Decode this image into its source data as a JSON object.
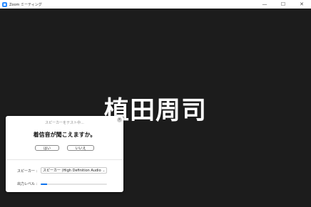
{
  "window": {
    "title": "Zoom ミーティング",
    "controls": [
      "—",
      "☐",
      "✕"
    ]
  },
  "participant": {
    "name": "植田周司"
  },
  "audio_test": {
    "status": "スピーカーをテスト中...",
    "question": "着信音が聞こえますか。",
    "yes_label": "はい",
    "no_label": "いいえ",
    "close_symbol": "×",
    "speaker_label": "スピーカー :",
    "speaker_value": "スピーカー (High Definition Audio Dev...",
    "output_label": "出力レベル :",
    "output_level": 0.1,
    "chevron": "⌄"
  },
  "colors": {
    "accent": "#2d8cff",
    "meter": "#0e72ed",
    "background": "#1c1c1c"
  }
}
